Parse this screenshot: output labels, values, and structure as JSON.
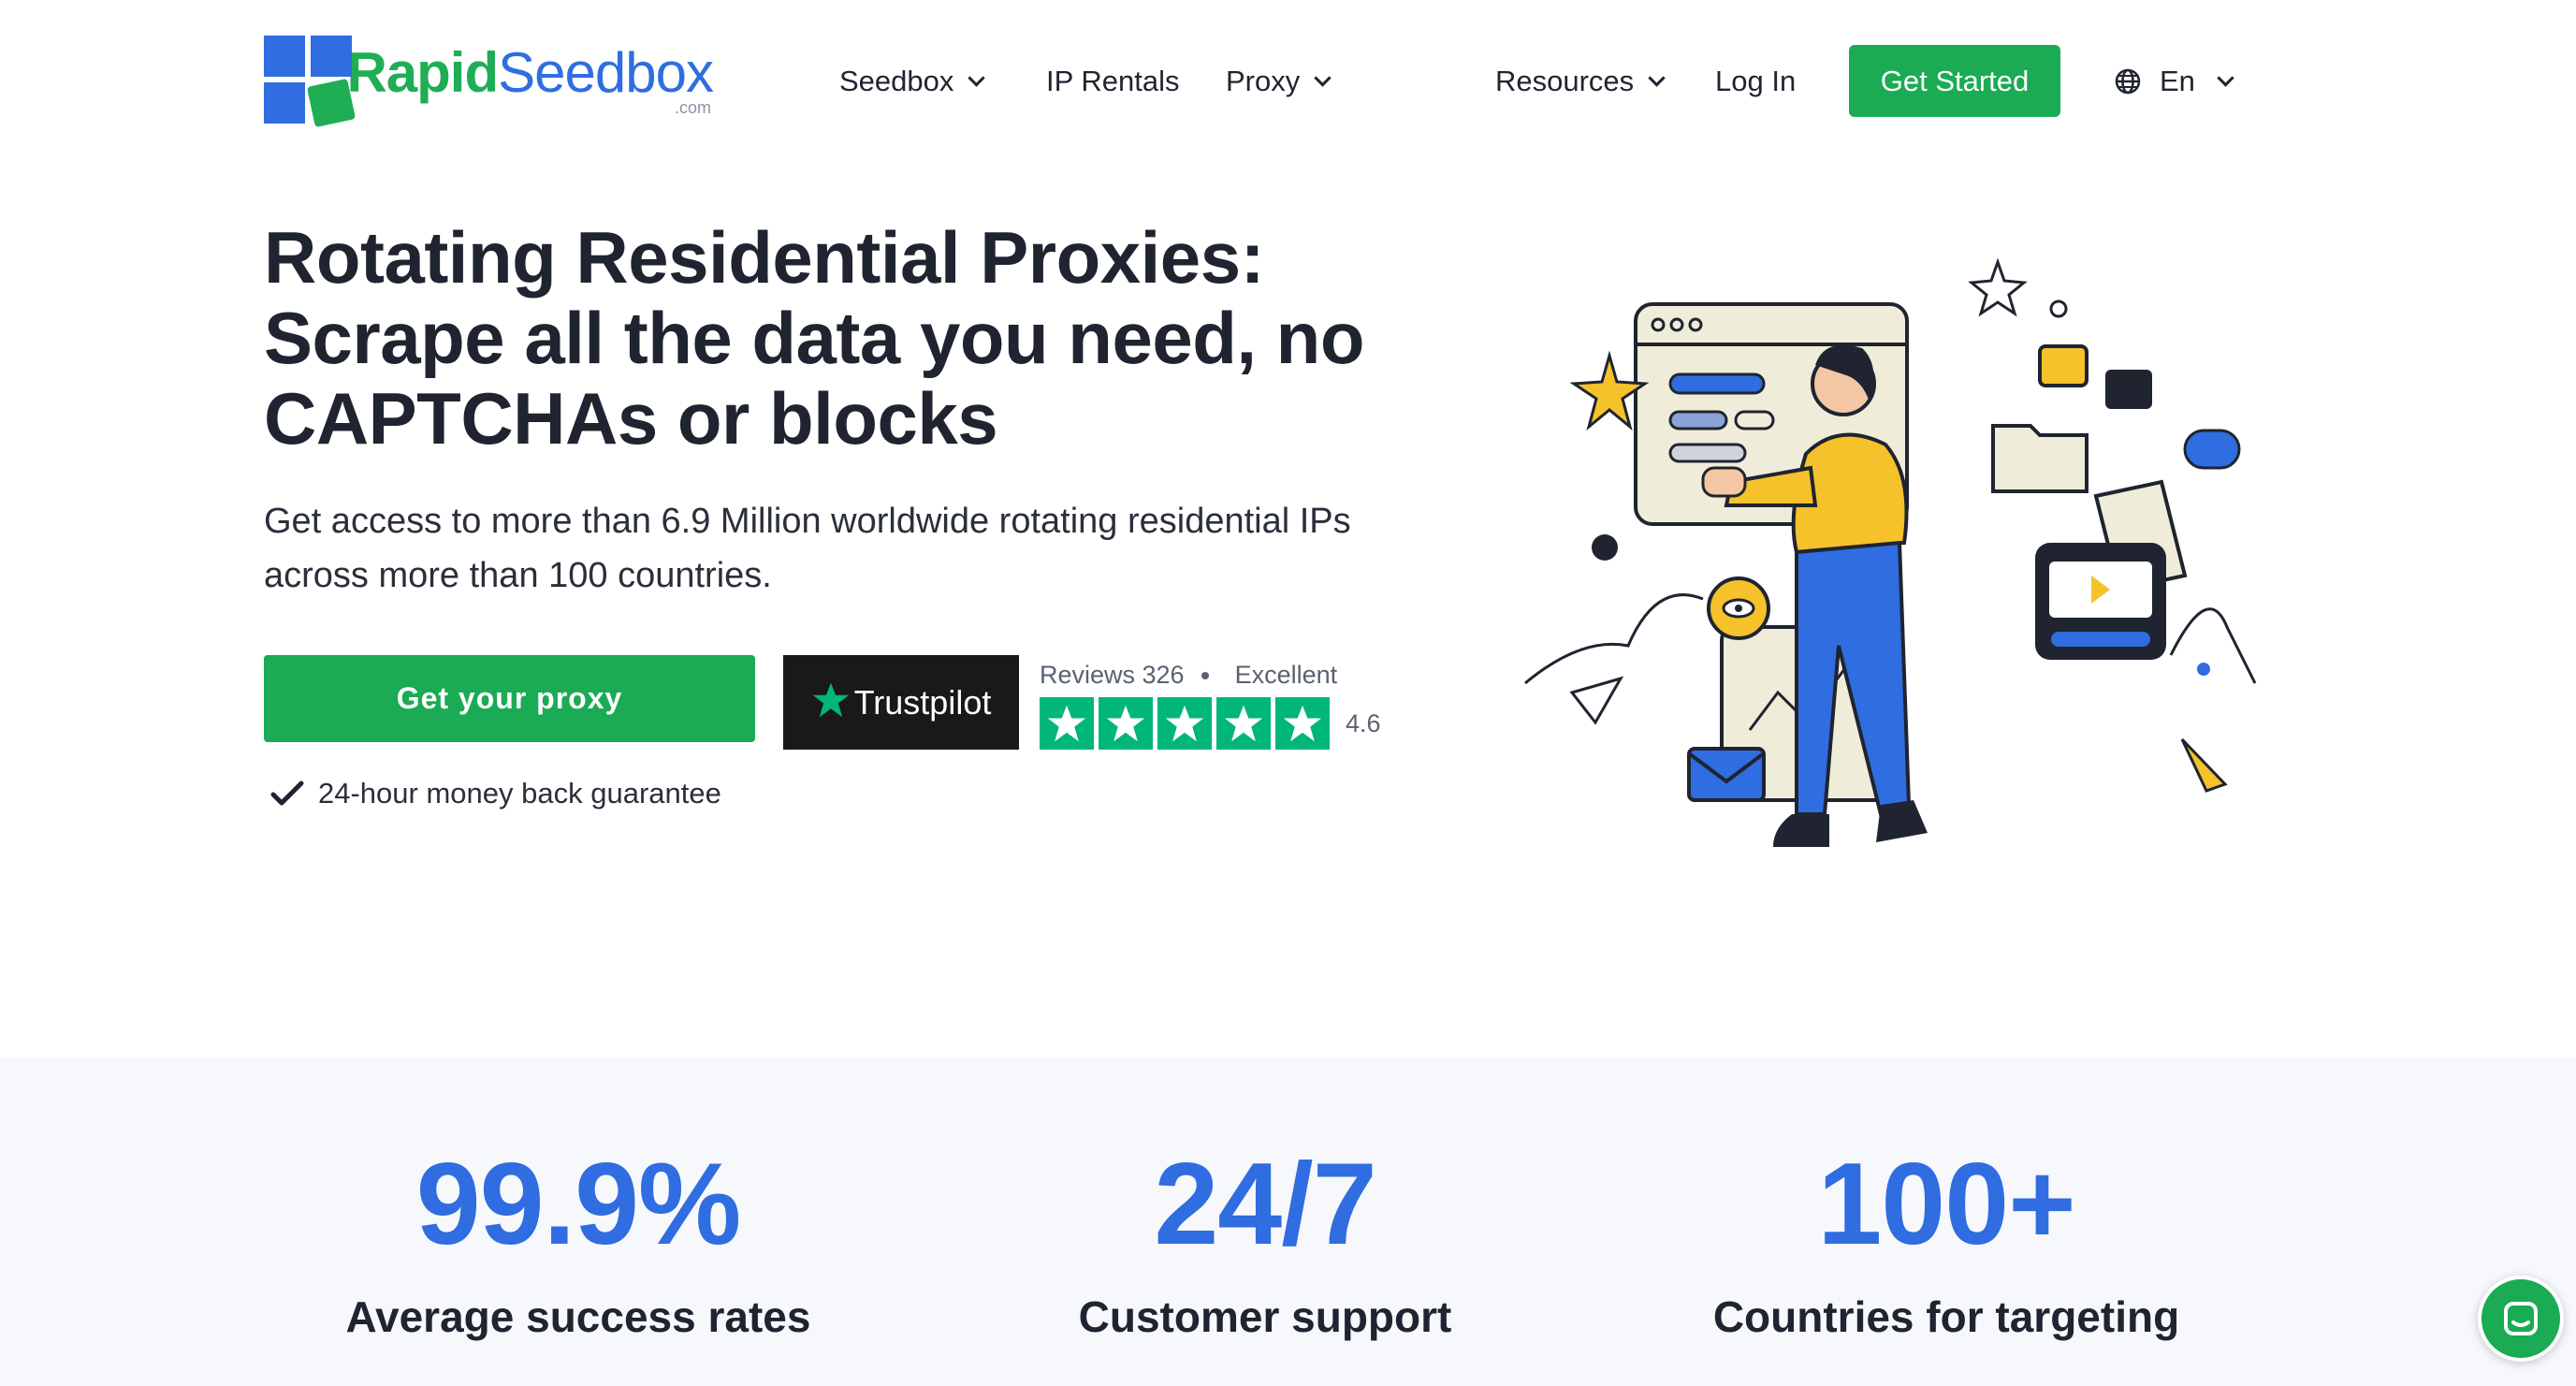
{
  "brand": {
    "name_part1": "Rapid",
    "name_part2": "Seedbox",
    "suffix": ".com",
    "primary_color": "#1aab54",
    "accent_color": "#2f6de0"
  },
  "nav": {
    "items": [
      {
        "label": "Seedbox",
        "has_dropdown": true
      },
      {
        "label": "IP Rentals",
        "has_dropdown": false
      },
      {
        "label": "Proxy",
        "has_dropdown": true
      },
      {
        "label": "Resources",
        "has_dropdown": true
      },
      {
        "label": "Log In",
        "has_dropdown": false
      }
    ],
    "cta_label": "Get Started",
    "language": "En",
    "language_icon": "globe-icon"
  },
  "hero": {
    "title_line1": "Rotating Residential Proxies:",
    "title_line2": "Scrape all the data you need, no",
    "title_line3": "CAPTCHAs or blocks",
    "subtitle": "Get access to more than 6.9 Million worldwide rotating residential IPs across more than 100 countries.",
    "cta_label": "Get your proxy",
    "guarantee": "24-hour money back guarantee"
  },
  "trustpilot": {
    "brand": "Trustpilot",
    "reviews_label": "Reviews 326",
    "rating_text": "Excellent",
    "score": "4.6",
    "stars": 5,
    "star_color": "#00b67a"
  },
  "stats": [
    {
      "value": "99.9%",
      "label": "Average success rates"
    },
    {
      "value": "24/7",
      "label": "Customer support"
    },
    {
      "value": "100+",
      "label": "Countries for targeting"
    }
  ],
  "chat": {
    "icon": "chat-icon"
  }
}
